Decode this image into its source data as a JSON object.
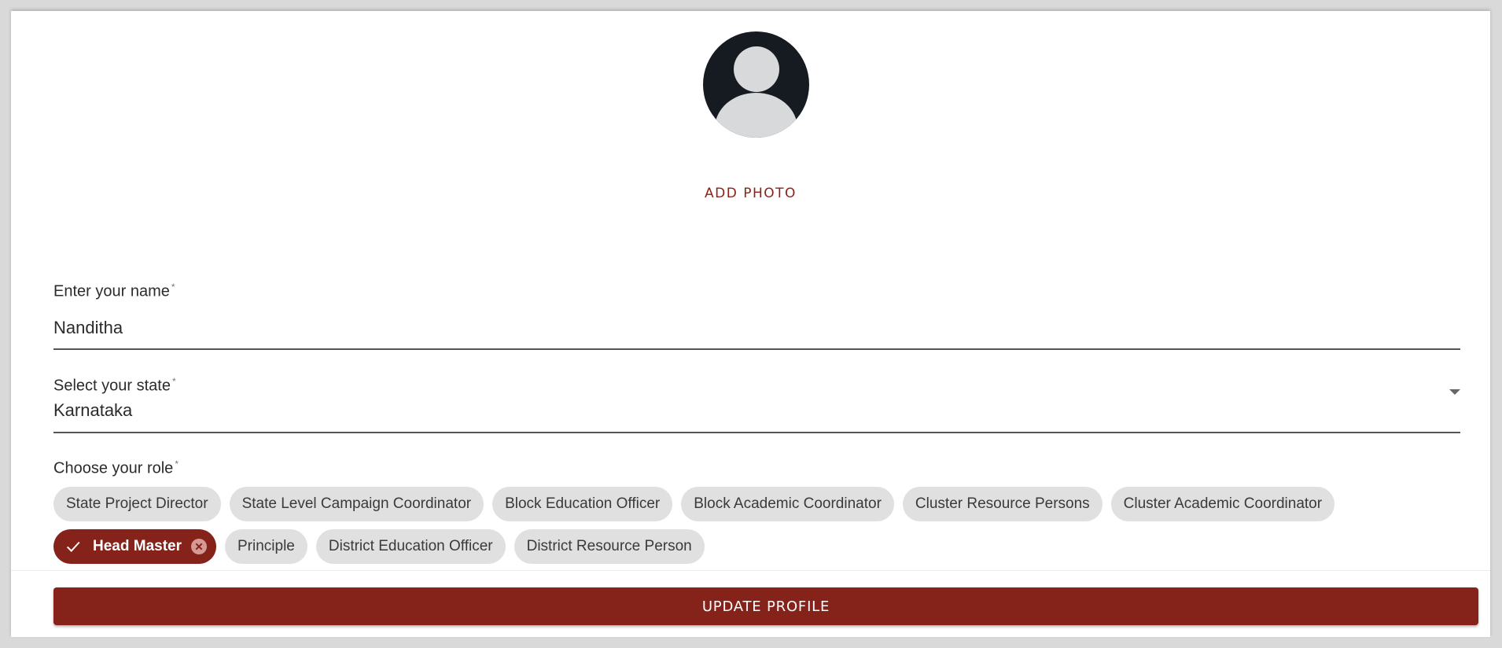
{
  "profile": {
    "add_photo_label": "ADD PHOTO"
  },
  "name_field": {
    "label": "Enter your name",
    "required_mark": "*",
    "value": "Nanditha"
  },
  "state_field": {
    "label": "Select your state",
    "required_mark": "*",
    "value": "Karnataka"
  },
  "role_field": {
    "label": "Choose your role",
    "required_mark": "*",
    "row1": [
      "State Project Director",
      "State Level Campaign Coordinator",
      "Block Education Officer",
      "Block Academic Coordinator",
      "Cluster Resource Persons",
      "Cluster Academic Coordinator"
    ],
    "selected": "Head Master",
    "row2": [
      "Principle",
      "District Education Officer",
      "District Resource Person"
    ]
  },
  "footer": {
    "update_label": "UPDATE PROFILE"
  },
  "colors": {
    "accent": "#85221a",
    "chip_bg": "#e0e0e0",
    "avatar_bg": "#161b22"
  },
  "icons": {
    "avatar": "user-avatar-icon",
    "selected_check": "check-icon",
    "remove_chip": "cancel-circle-icon",
    "dropdown": "caret-down-icon"
  }
}
